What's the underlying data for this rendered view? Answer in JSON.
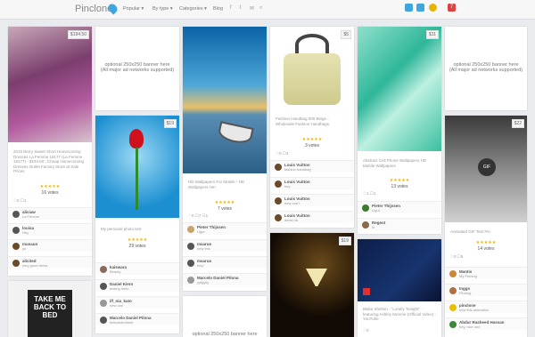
{
  "header": {
    "logo": "Pinclone",
    "nav": [
      "Popular ▾",
      "By type ▾",
      "Categories ▾",
      "Blog"
    ],
    "social": [
      "f",
      "t",
      "✉",
      "⌕"
    ],
    "notif_count": "7"
  },
  "cards": {
    "c1": {
      "price": "$194.50",
      "desc": "2015 Berry Sweet Short Homecoming Dresses La Femme 18177 (La Femme 18177) - $194.50 : Cheap Homecoming Dresses Outlet Factory Store at Sale Prices",
      "stars": "★★★★★",
      "votes": "16 votes",
      "stat": "♡0 ☐1",
      "comments": [
        {
          "name": "aliciaw",
          "text": "La Femme"
        },
        {
          "name": "louisa",
          "text": "Hey"
        },
        {
          "name": "musaun",
          "text": "yo"
        },
        {
          "name": "alicited",
          "text": "very good dress"
        }
      ]
    },
    "c2": {
      "banner": "optional 250x250 banner here\n(All major ad networks supported)"
    },
    "c3": {
      "price": "$19",
      "desc": "My personal photo test",
      "stars": "★★★★★",
      "votes": "29 votes",
      "comments": [
        {
          "name": "kaiswara",
          "text": "Beauty"
        },
        {
          "name": "Daniel Kiern",
          "text": "testing hello"
        },
        {
          "name": "ilf_nia_kato",
          "text": "new one"
        },
        {
          "name": "Marcelo Daniel Pilona",
          "text": "beleanderlaner"
        }
      ]
    },
    "c4": {
      "desc": "HD Wallpapers For Mobile - HD Wallpapers Hm",
      "stars": "★★★★★",
      "votes": "7 votes",
      "stat": "♡0 ☐7 ☷1",
      "comments": [
        {
          "name": "Pieter Thijssen",
          "text": "Ugut"
        },
        {
          "name": "msaruo",
          "text": "new this"
        },
        {
          "name": "msaruo",
          "text": "hey!"
        },
        {
          "name": "Marcelo Daniel Pilona",
          "text": "yyfgyfg"
        }
      ]
    },
    "c5": {
      "banner": "optional 250x250 banner here\n(All major ad networks supported)"
    },
    "c6": {
      "price": "$5",
      "desc": "Fashion Handbag 009 Beige - Wholesale Fashion Handbags",
      "stars": "★★★★★",
      "votes": "3 votes",
      "stat": "♡0 ☐3",
      "comments": [
        {
          "name": "Louis Vuitton",
          "text": "fashion handbag"
        },
        {
          "name": "Louis Vuitton",
          "text": "hey"
        },
        {
          "name": "Louis Vuitton",
          "text": "new one?"
        },
        {
          "name": "Louis Vuitton",
          "text": "demo ok"
        }
      ]
    },
    "c7": {
      "price": "$19"
    },
    "c8": {
      "price": "$11",
      "desc": "Abstract Cell Phone Wallpapers HD Mobile Wallpapers",
      "stars": "★★★★★",
      "votes": "13 votes",
      "stat": "♡1 ☐1",
      "comments": [
        {
          "name": "Pieter Thijssen",
          "text": "Ligut"
        },
        {
          "name": "Regent",
          "text": "hi"
        }
      ]
    },
    "c9": {
      "desc": "Blake Shelton - \"Lonely Tonight\" featuring Ashley Monroe (Official Video) - YouTube",
      "stat": "♡0"
    },
    "c10": {
      "banner": "optional 250x250 banner here\n(All major ad networks supported)"
    },
    "c11": {
      "price": "$22",
      "gif": "GIF",
      "desc": "Animated GIF Test Pin",
      "stars": "★★★★★",
      "votes": "14 votes",
      "stat": "♡0 ☐5",
      "comments": [
        {
          "name": "Mantis",
          "text": "My Pinning"
        },
        {
          "name": "Inggs",
          "text": "Pinning"
        },
        {
          "name": "pinclone",
          "text": "new this animation"
        },
        {
          "name": "Abdur Rasheed Hassan",
          "text": "hey, nice one"
        }
      ]
    },
    "c12": {
      "text": "TAKE ME BACK TO BED"
    },
    "c13": {
      "banner": "optional 250x250 banner here"
    }
  },
  "colors": {
    "accent": "#3fa7dd",
    "star": "#f0b400",
    "notif": "#e04040"
  }
}
